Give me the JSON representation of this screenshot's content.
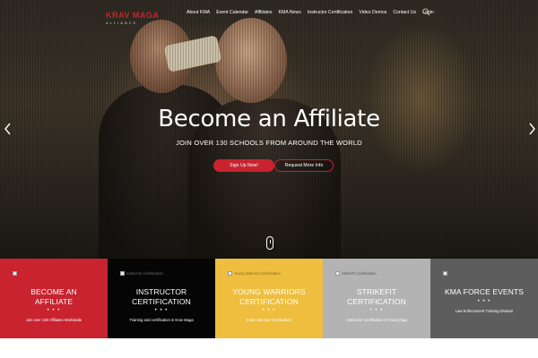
{
  "logo": {
    "main": "KRAV MAGA",
    "sub": "ALLIANCE"
  },
  "nav": {
    "items": [
      "About KMA",
      "Event Calendar",
      "Affiliates",
      "KMA News",
      "Instructor Certification",
      "Video Demos",
      "Contact Us",
      "Login"
    ],
    "search_icon": "search-icon"
  },
  "hero": {
    "title": "Become an Affiliate",
    "subtitle": "JOIN OVER 130 SCHOOLS FROM AROUND THE WORLD",
    "signup_label": "Sign Up Now!",
    "request_label": "Request More Info"
  },
  "tiles": [
    {
      "image_alt": "",
      "title_line1": "BECOME AN",
      "title_line2": "AFFILIATE",
      "dots": "• • •",
      "desc": "Join over 130 Affiliates Worldwide",
      "bg": "#c8232f",
      "fg": "#ffffff"
    },
    {
      "image_alt": "Instructor Certification",
      "title_line1": "INSTRUCTOR",
      "title_line2": "CERTIFICATION",
      "dots": "• • •",
      "desc": "Training and certification in Krav Maga",
      "bg": "#050505",
      "fg": "#ffffff"
    },
    {
      "image_alt": "Young Warriors Certification",
      "title_line1": "YOUNG WARRIORS",
      "title_line2": "CERTIFICATION",
      "dots": "• • •",
      "desc": "Kids Instructor Certification",
      "bg": "#efbe3f",
      "fg": "#ffffff"
    },
    {
      "image_alt": "StrikeFit Certification",
      "title_line1": "STRIKEFIT",
      "title_line2": "CERTIFICATION",
      "dots": "• • •",
      "desc": "Instructor Certification for heavy bag",
      "bg": "#b3b3b3",
      "fg": "#ffffff"
    },
    {
      "image_alt": "",
      "title_line1": "KMA FORCE EVENTS",
      "title_line2": "",
      "dots": "• • •",
      "desc": "Law Enforcement Training Division",
      "bg": "#5d5d5d",
      "fg": "#ffffff"
    }
  ],
  "colors": {
    "accent": "#c8232f"
  }
}
